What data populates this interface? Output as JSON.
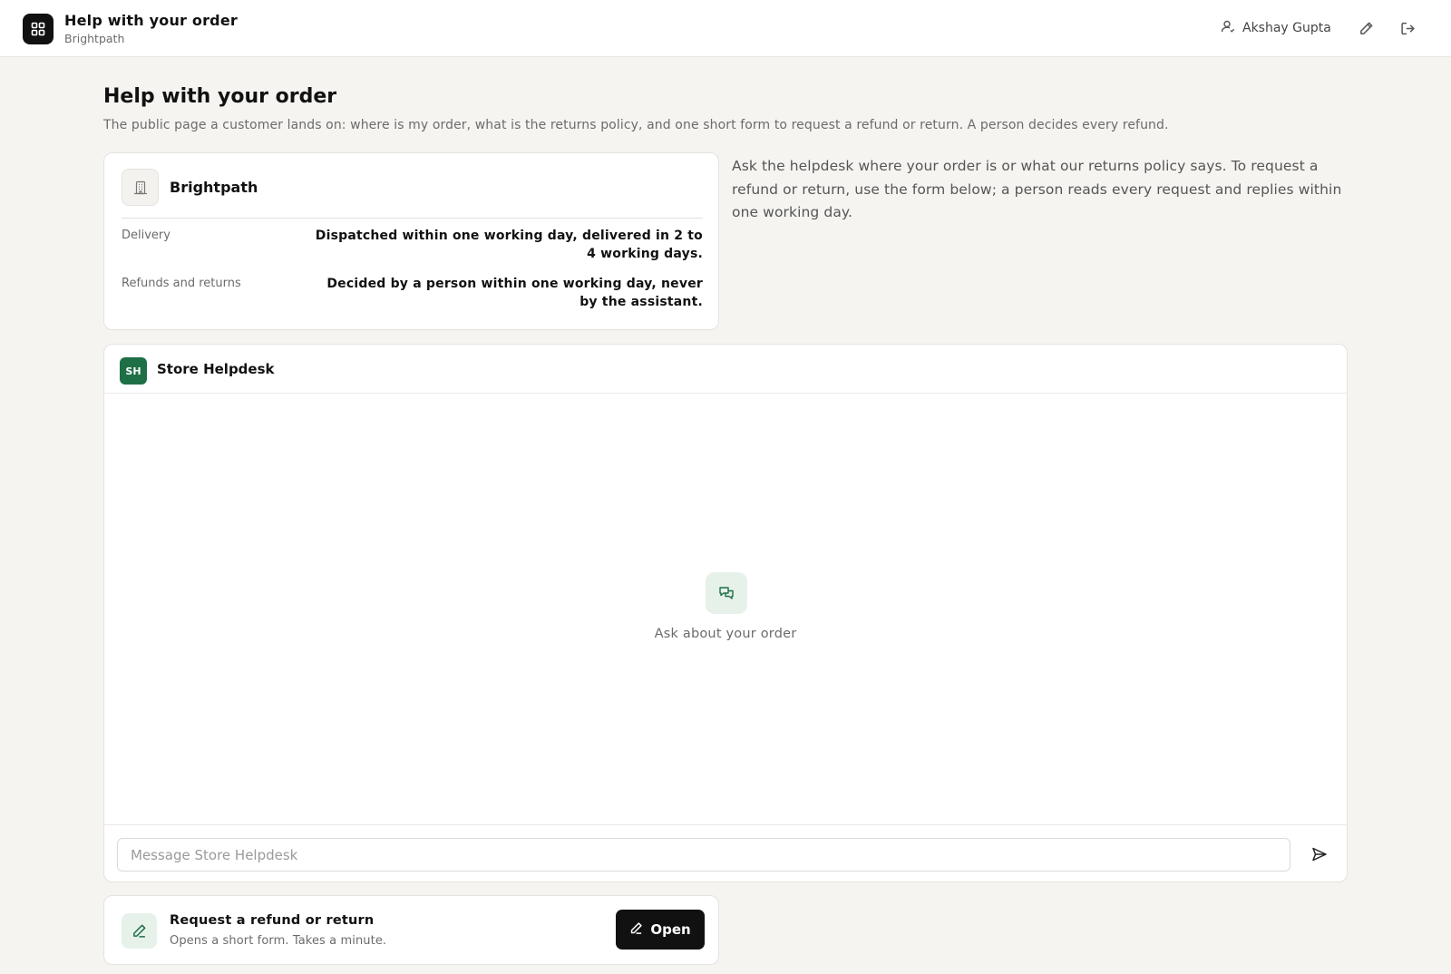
{
  "header": {
    "title": "Help with your order",
    "subtitle": "Brightpath",
    "user_name": "Akshay Gupta"
  },
  "page": {
    "title": "Help with your order",
    "description": "The public page a customer lands on: where is my order, what is the returns policy, and one short form to request a refund or return. A person decides every refund."
  },
  "store": {
    "name": "Brightpath",
    "rows": [
      {
        "label": "Delivery",
        "value": "Dispatched within one working day, delivered in 2 to 4 working days."
      },
      {
        "label": "Refunds and returns",
        "value": "Decided by a person within one working day, never by the assistant."
      }
    ]
  },
  "side_note": "Ask the helpdesk where your order is or what our returns policy says. To request a refund or return, use the form below; a person reads every request and replies within one working day.",
  "chat": {
    "avatar_initials": "SH",
    "bot_name": "Store Helpdesk",
    "empty_text": "Ask about your order",
    "input_placeholder": "Message Store Helpdesk",
    "input_value": ""
  },
  "refund": {
    "title": "Request a refund or return",
    "subtitle": "Opens a short form. Takes a minute.",
    "button_label": "Open"
  },
  "colors": {
    "accent_green": "#1f6f46",
    "soft_green": "#e6f1ea",
    "background": "#f5f4f1",
    "primary_button": "#111111"
  }
}
